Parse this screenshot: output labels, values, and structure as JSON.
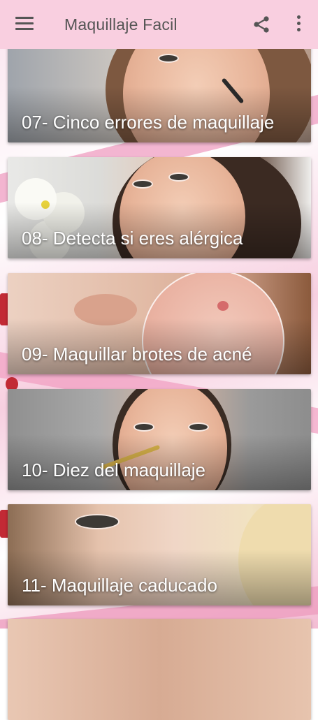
{
  "app": {
    "title": "Maquillaje Facil",
    "icons": {
      "menu": "menu-icon",
      "share": "share-icon",
      "more": "more-vert-icon"
    },
    "colors": {
      "appbar": "#f9cfe0",
      "text": "#555555",
      "label": "#ffffff",
      "accent": "#ef9ec2"
    }
  },
  "cards": [
    {
      "label": "07- Cinco errores de maquillaje"
    },
    {
      "label": "08- Detecta si eres alérgica"
    },
    {
      "label": "09- Maquillar brotes de acné"
    },
    {
      "label": "10- Diez del maquillaje"
    },
    {
      "label": "11- Maquillaje caducado"
    },
    {
      "label": ""
    }
  ]
}
